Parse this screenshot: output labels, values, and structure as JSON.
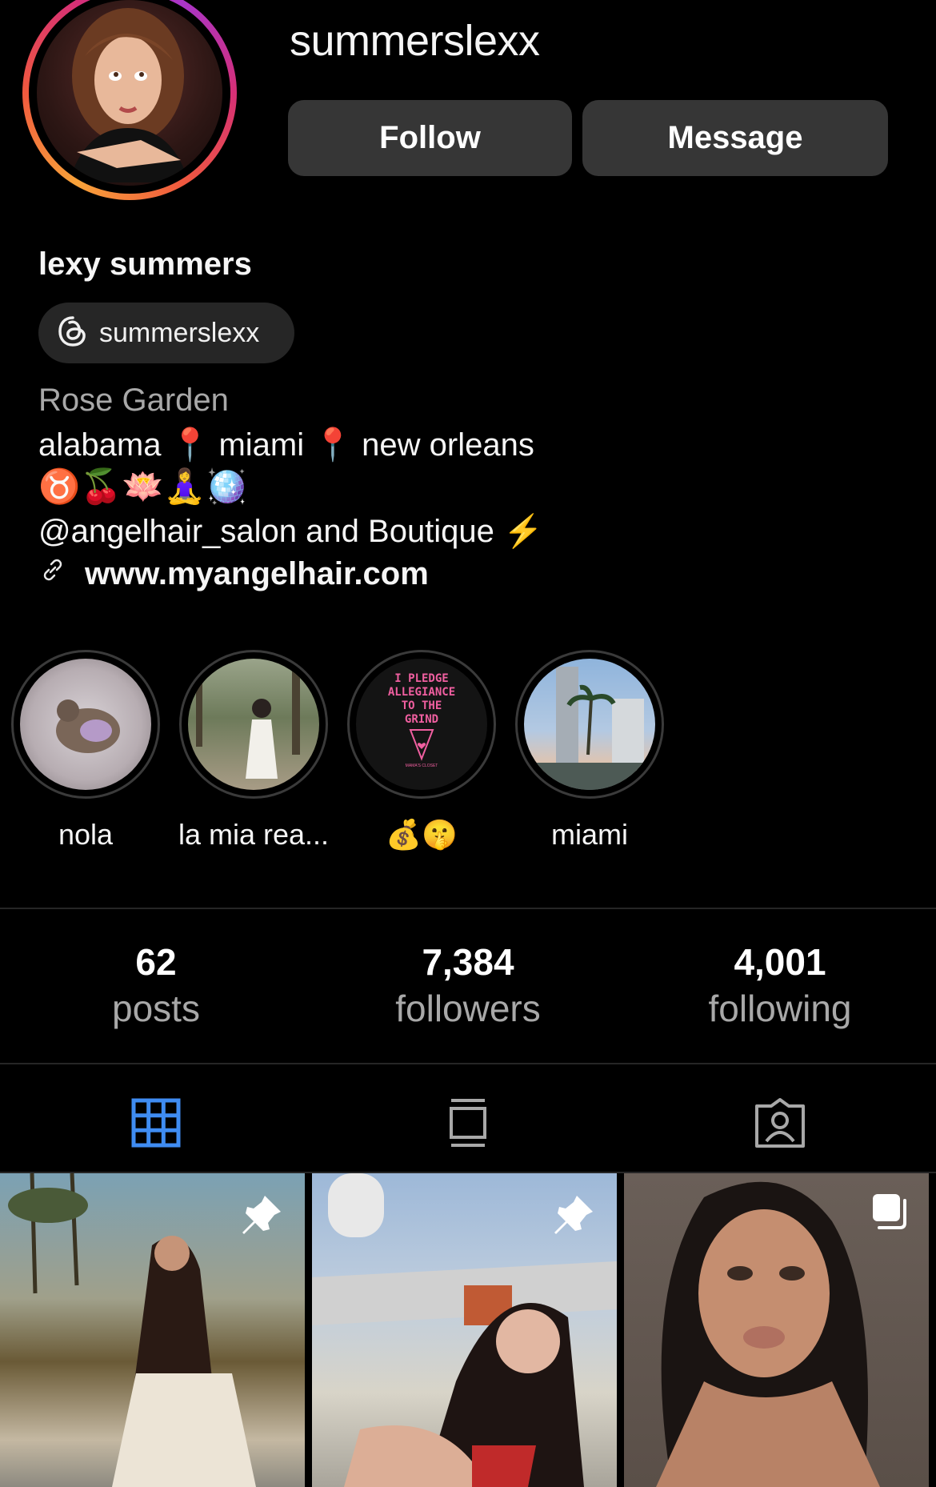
{
  "header": {
    "username": "summerslexx",
    "follow_label": "Follow",
    "message_label": "Message"
  },
  "profile": {
    "display_name": "lexy summers",
    "threads_handle": "summerslexx",
    "category": "Rose Garden",
    "bio_line1": "alabama 📍 miami 📍 new orleans",
    "bio_line2": "♉️🍒🪷🧘‍♀️🪩",
    "bio_line3": "@angelhair_salon and Boutique ⚡️",
    "link": "www.myangelhair.com"
  },
  "highlights": [
    {
      "label": "nola"
    },
    {
      "label": "la mia rea..."
    },
    {
      "label": "💰🤫",
      "cover_text": "I PLEDGE ALLEGIANCE TO THE GRIND",
      "cover_subtext": "MAMA'S CLOSET"
    },
    {
      "label": "miami"
    }
  ],
  "stats": [
    {
      "value": "62",
      "label": "posts"
    },
    {
      "value": "7,384",
      "label": "followers"
    },
    {
      "value": "4,001",
      "label": "following"
    }
  ],
  "tabs": [
    {
      "icon": "grid-icon",
      "active": true
    },
    {
      "icon": "reels-icon",
      "active": false
    },
    {
      "icon": "tagged-icon",
      "active": false
    }
  ],
  "posts": [
    {
      "badge": "pin-icon"
    },
    {
      "badge": "pin-icon"
    },
    {
      "badge": "carousel-icon"
    }
  ],
  "colors": {
    "active_tab": "#3f8cf2",
    "button_bg": "#363636",
    "muted_text": "#a8a8a8"
  }
}
